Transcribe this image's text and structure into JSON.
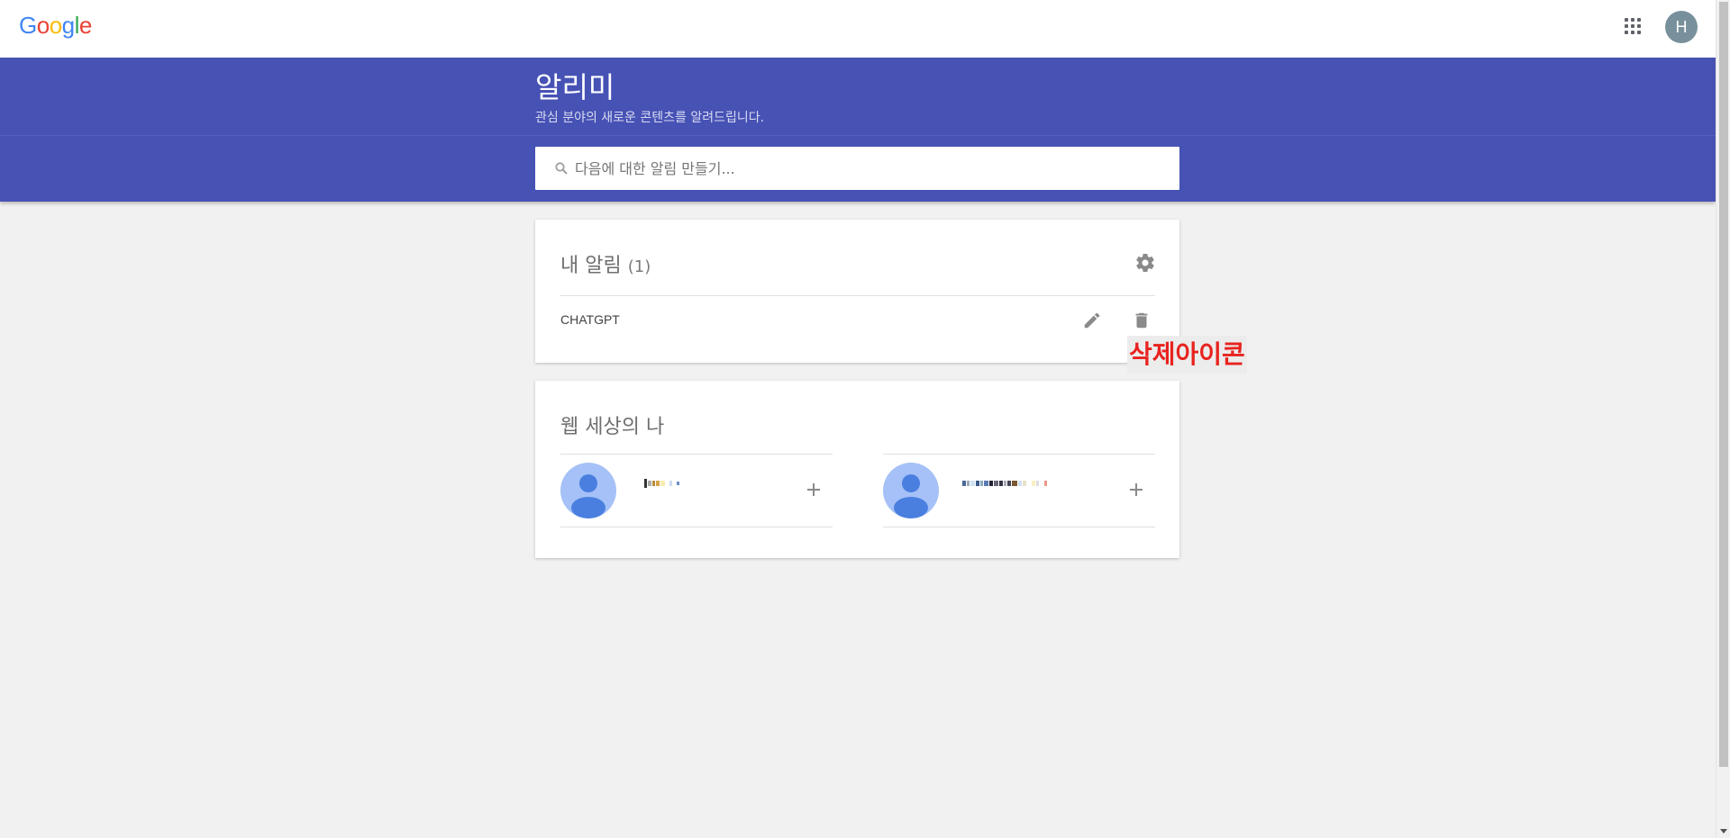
{
  "topbar": {
    "logo_letters": [
      {
        "ch": "G",
        "color": "#4285f4"
      },
      {
        "ch": "o",
        "color": "#ea4335"
      },
      {
        "ch": "o",
        "color": "#fbbc05"
      },
      {
        "ch": "g",
        "color": "#4285f4"
      },
      {
        "ch": "l",
        "color": "#34a853"
      },
      {
        "ch": "e",
        "color": "#ea4335"
      }
    ],
    "avatar_initial": "H"
  },
  "header": {
    "title": "알리미",
    "subtitle": "관심 분야의 새로운 콘텐츠를 알려드립니다.",
    "search_placeholder": "다음에 대한 알림 만들기..."
  },
  "alerts_card": {
    "title": "내 알림",
    "count": "(1)",
    "items": [
      {
        "name": "CHATGPT"
      }
    ]
  },
  "annotation": {
    "text": "삭제아이콘"
  },
  "me_on_web_card": {
    "title": "웹 세상의 나"
  },
  "colors": {
    "header_bg": "#4752b5",
    "page_bg": "#f1f1f1",
    "annotation_text": "#e8231f"
  }
}
